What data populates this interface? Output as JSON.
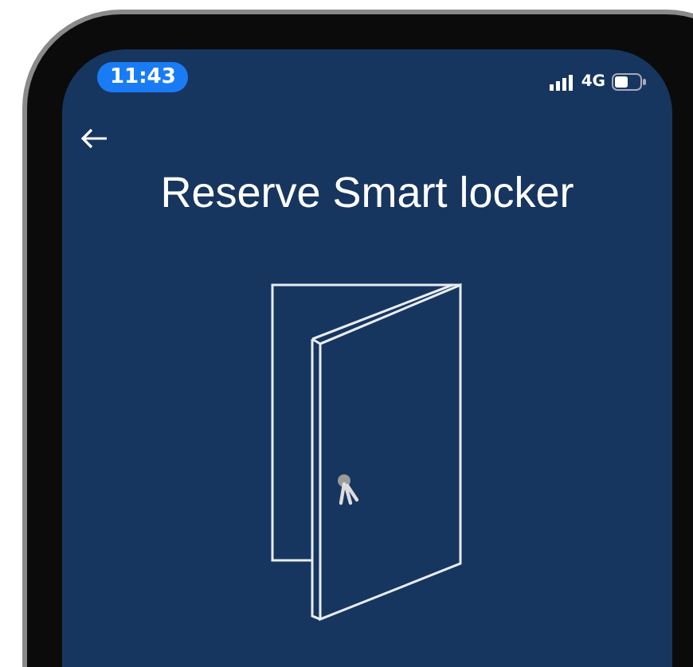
{
  "status_bar": {
    "time": "11:43",
    "network": "4G"
  },
  "screen": {
    "title": "Reserve Smart locker"
  }
}
